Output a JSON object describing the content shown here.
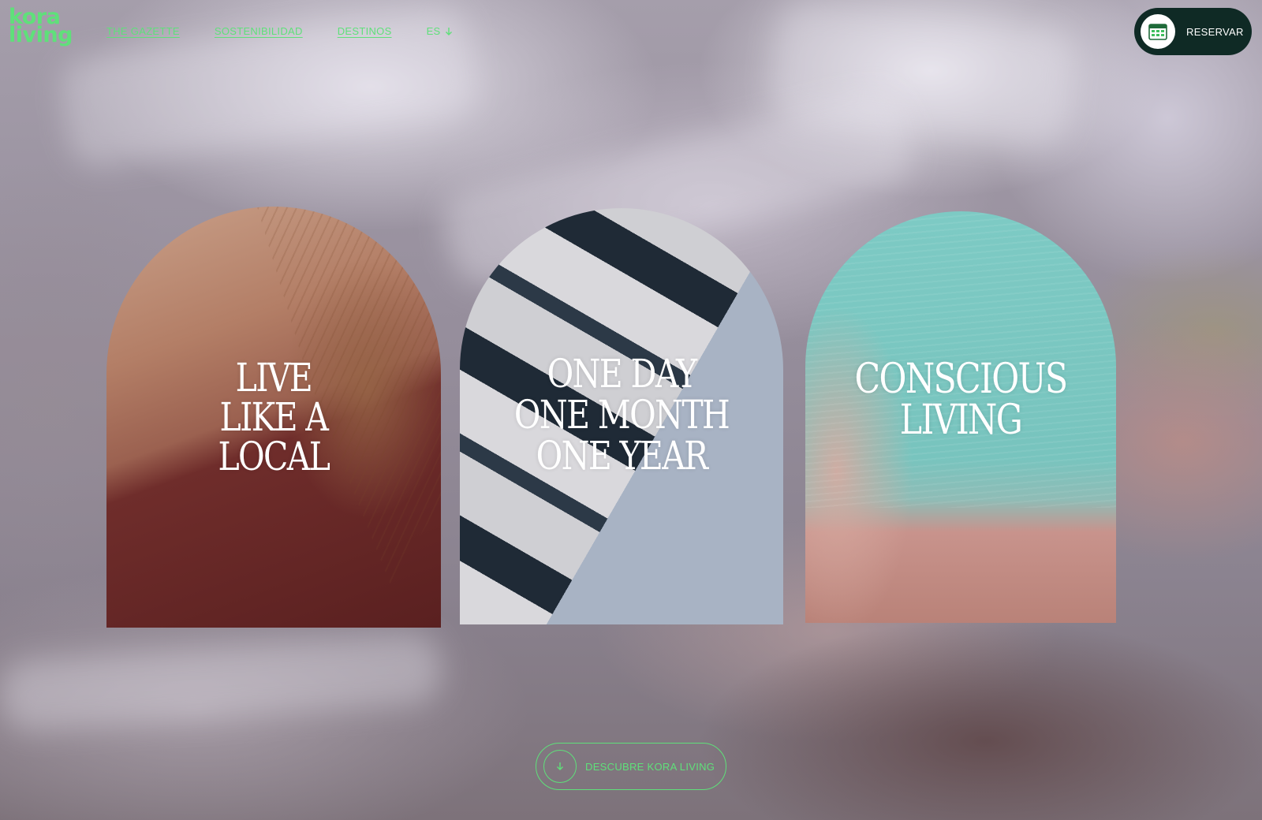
{
  "brand": {
    "logo_line1": "kora",
    "logo_line2": "living",
    "accent_color": "#5fe07a",
    "dark_color": "#0f2a25"
  },
  "nav": {
    "items": [
      {
        "label": "THE GAZETTE"
      },
      {
        "label": "SOSTENIBILIDAD"
      },
      {
        "label": "DESTINOS"
      }
    ],
    "language": "ES",
    "language_icon": "arrow-down-icon"
  },
  "reserve": {
    "label": "RESERVAR",
    "icon": "calendar-icon"
  },
  "arches": [
    {
      "lines": [
        "LIVE",
        "LIKE A",
        "LOCAL"
      ]
    },
    {
      "lines": [
        "ONE DAY",
        "ONE MONTH",
        "ONE YEAR"
      ]
    },
    {
      "lines": [
        "CONSCIOUS",
        "LIVING"
      ]
    }
  ],
  "discover": {
    "label": "DESCUBRE KORA LIVING",
    "icon": "arrow-down-icon"
  }
}
